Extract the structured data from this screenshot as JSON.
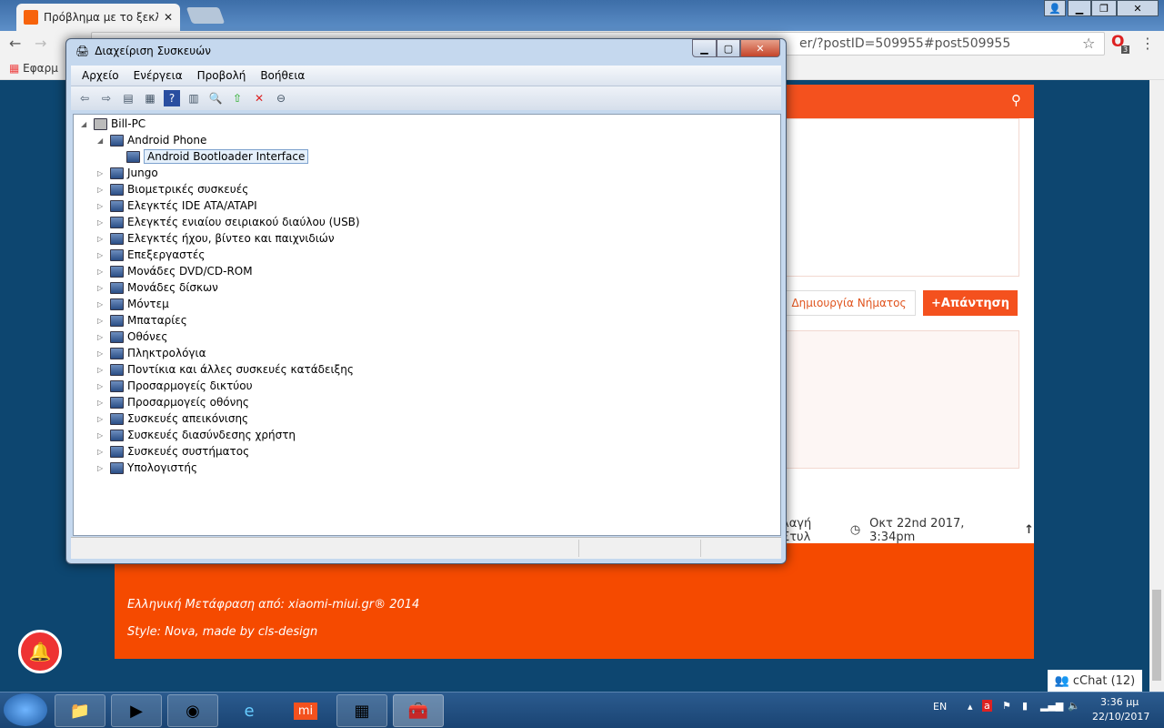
{
  "browser": {
    "tab_title": "Πρόβλημα με το ξεκλείδ",
    "url": "er/?postID=509955#post509955",
    "bookmarks_label": "Εφαρμ",
    "extension_badge": "3"
  },
  "page": {
    "btn_new_thread": "Δημιουργία Νήματος",
    "btn_reply": "Απάντηση",
    "meta_style": "λαγή Στυλ",
    "meta_date": "Οκτ 22nd 2017, 3:34pm",
    "footer_translation": "Ελληνική Μετάφραση από: xiaomi-miui.gr® 2014",
    "footer_style": "Style: Nova, made by cls-design",
    "cchat": "cChat (12)"
  },
  "device_manager": {
    "title": "Διαχείριση Συσκευών",
    "menu": [
      "Αρχείο",
      "Ενέργεια",
      "Προβολή",
      "Βοήθεια"
    ],
    "root": "Bill-PC",
    "expanded": "Android Phone",
    "selected_child": "Android Bootloader Interface",
    "categories": [
      "Jungo",
      "Βιομετρικές συσκευές",
      "Ελεγκτές IDE ATA/ATAPI",
      "Ελεγκτές ενιαίου σειριακού διαύλου (USB)",
      "Ελεγκτές ήχου, βίντεο και παιχνιδιών",
      "Επεξεργαστές",
      "Μονάδες DVD/CD-ROM",
      "Μονάδες δίσκων",
      "Μόντεμ",
      "Μπαταρίες",
      "Οθόνες",
      "Πληκτρολόγια",
      "Ποντίκια και άλλες συσκευές κατάδειξης",
      "Προσαρμογείς δικτύου",
      "Προσαρμογείς οθόνης",
      "Συσκευές απεικόνισης",
      "Συσκευές διασύνδεσης χρήστη",
      "Συσκευές συστήματος",
      "Υπολογιστής"
    ]
  },
  "taskbar": {
    "lang": "EN",
    "time": "3:36 μμ",
    "date": "22/10/2017"
  }
}
